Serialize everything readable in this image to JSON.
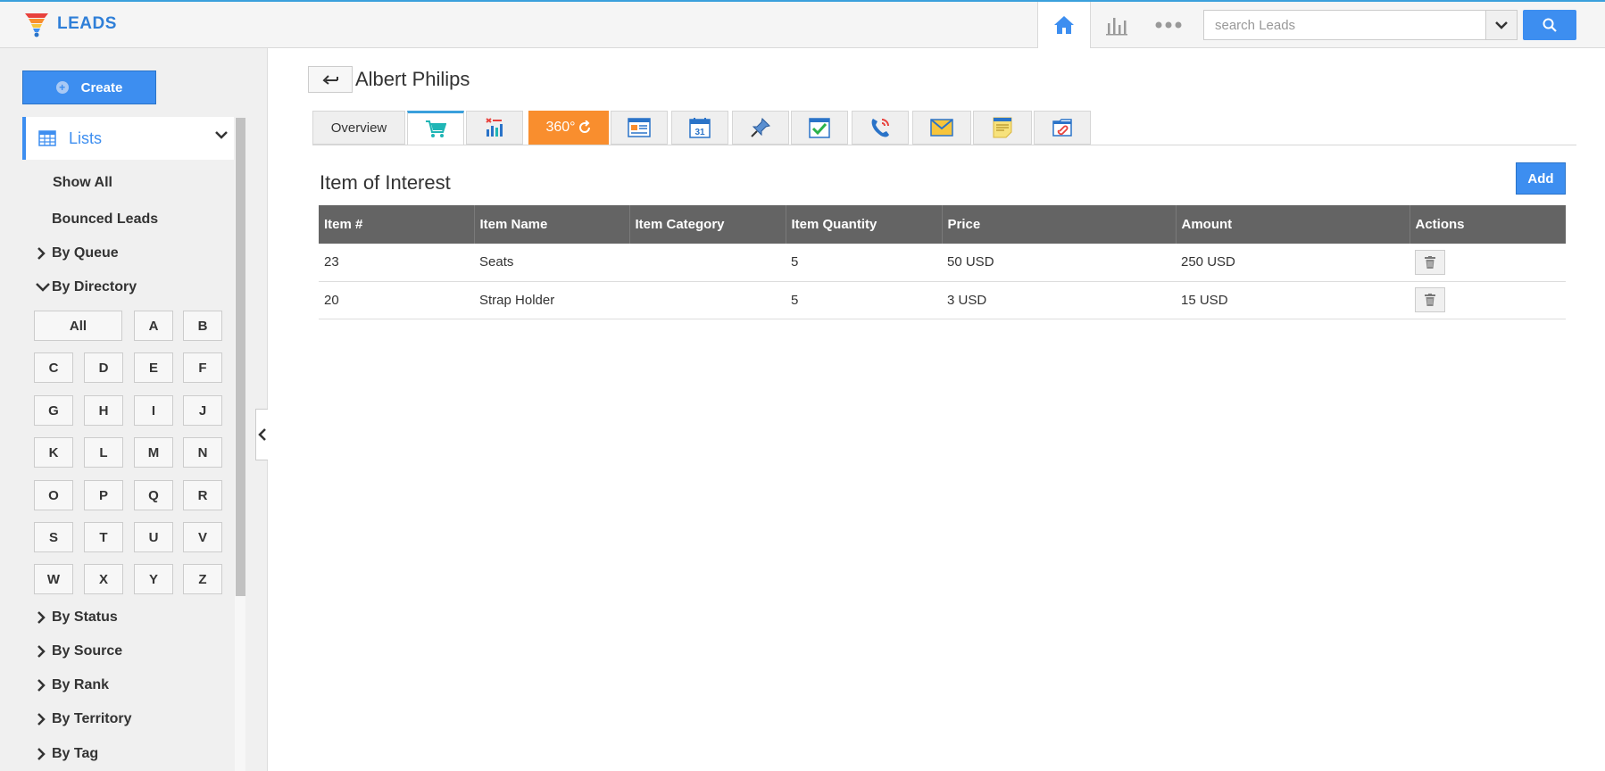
{
  "app": {
    "name": "LEADS"
  },
  "search": {
    "placeholder": "search Leads"
  },
  "sidebar": {
    "create_label": "Create",
    "lists_label": "Lists",
    "links": [
      "Show All",
      "Bounced Leads"
    ],
    "by_queue": "By Queue",
    "by_directory": "By Directory",
    "directory_letters": [
      "All",
      "A",
      "B",
      "C",
      "D",
      "E",
      "F",
      "G",
      "H",
      "I",
      "J",
      "K",
      "L",
      "M",
      "N",
      "O",
      "P",
      "Q",
      "R",
      "S",
      "T",
      "U",
      "V",
      "W",
      "X",
      "Y",
      "Z"
    ],
    "groups": [
      "By Status",
      "By Source",
      "By Rank",
      "By Territory",
      "By Tag"
    ]
  },
  "lead": {
    "name": "Albert Philips"
  },
  "tabs": {
    "overview": "Overview",
    "three_sixty": "360°",
    "icons": [
      "cart-icon",
      "report-icon",
      "360-icon",
      "news-icon",
      "calendar-icon",
      "pin-icon",
      "task-icon",
      "phone-icon",
      "mail-icon",
      "note-icon",
      "attachment-icon"
    ],
    "calendar_day": "31"
  },
  "section": {
    "title": "Item of Interest",
    "add_label": "Add"
  },
  "table": {
    "headers": [
      "Item #",
      "Item Name",
      "Item Category",
      "Item Quantity",
      "Price",
      "Amount",
      "Actions"
    ],
    "rows": [
      [
        "23",
        "Seats",
        "",
        "5",
        "50 USD",
        "250 USD"
      ],
      [
        "20",
        "Strap Holder",
        "",
        "5",
        "3 USD",
        "15 USD"
      ]
    ]
  },
  "colors": {
    "accent": "#3d8ef0",
    "tab_top": "#3aa0dc",
    "orange": "#f98e2e",
    "table_header": "#646464"
  }
}
